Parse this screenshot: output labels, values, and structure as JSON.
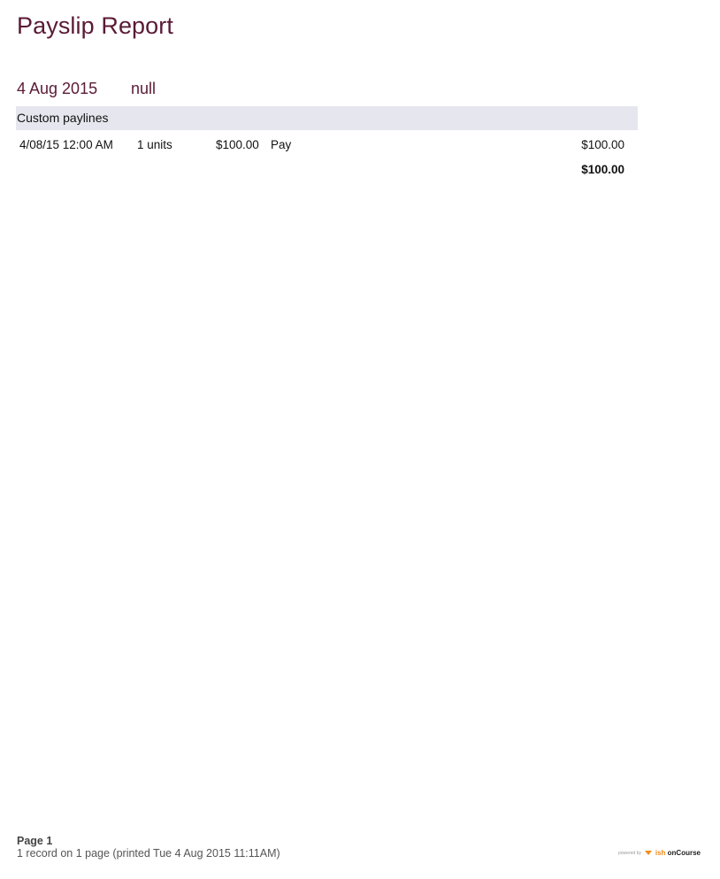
{
  "report": {
    "title": "Payslip Report"
  },
  "payslip": {
    "date": "4 Aug 2015",
    "name": "null"
  },
  "section": {
    "title": "Custom paylines"
  },
  "paylines": [
    {
      "date": "4/08/15 12:00 AM",
      "units": "1 units",
      "rate": "$100.00",
      "description": "Pay",
      "amount": "$100.00"
    }
  ],
  "total": "$100.00",
  "footer": {
    "page": "Page 1",
    "summary": "1 record on 1 page (printed Tue 4 Aug 2015 11:11AM)"
  },
  "branding": {
    "powered_by": "powered by",
    "brand_prefix": "ish",
    "brand_name": "onCourse"
  },
  "colors": {
    "title": "#5a1a36",
    "section_bg": "#e6e6ef",
    "brand_accent": "#f28c1b"
  }
}
